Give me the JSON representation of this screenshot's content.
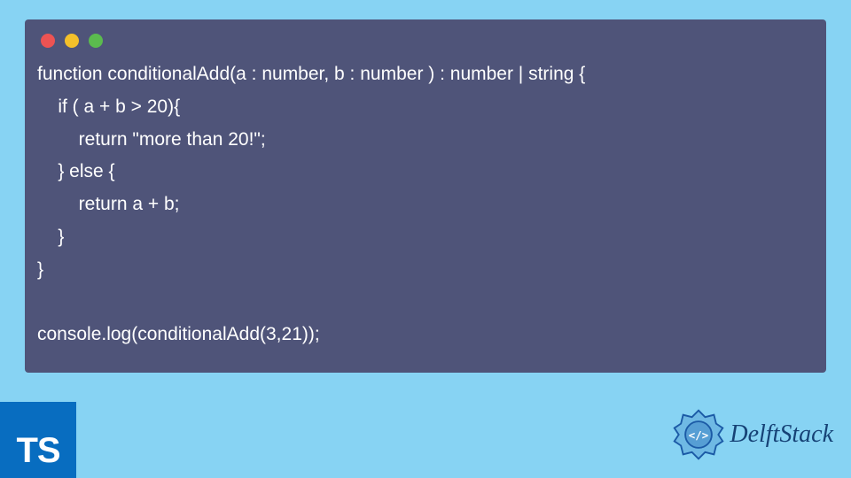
{
  "code": {
    "lines": [
      "function conditionalAdd(a : number, b : number ) : number | string {",
      "    if ( a + b > 20){",
      "        return \"more than 20!\";",
      "    } else {",
      "        return a + b;",
      "    }",
      "}",
      "",
      "console.log(conditionalAdd(3,21));"
    ]
  },
  "badge": {
    "text": "TS"
  },
  "brand": {
    "name": "DelftStack"
  }
}
